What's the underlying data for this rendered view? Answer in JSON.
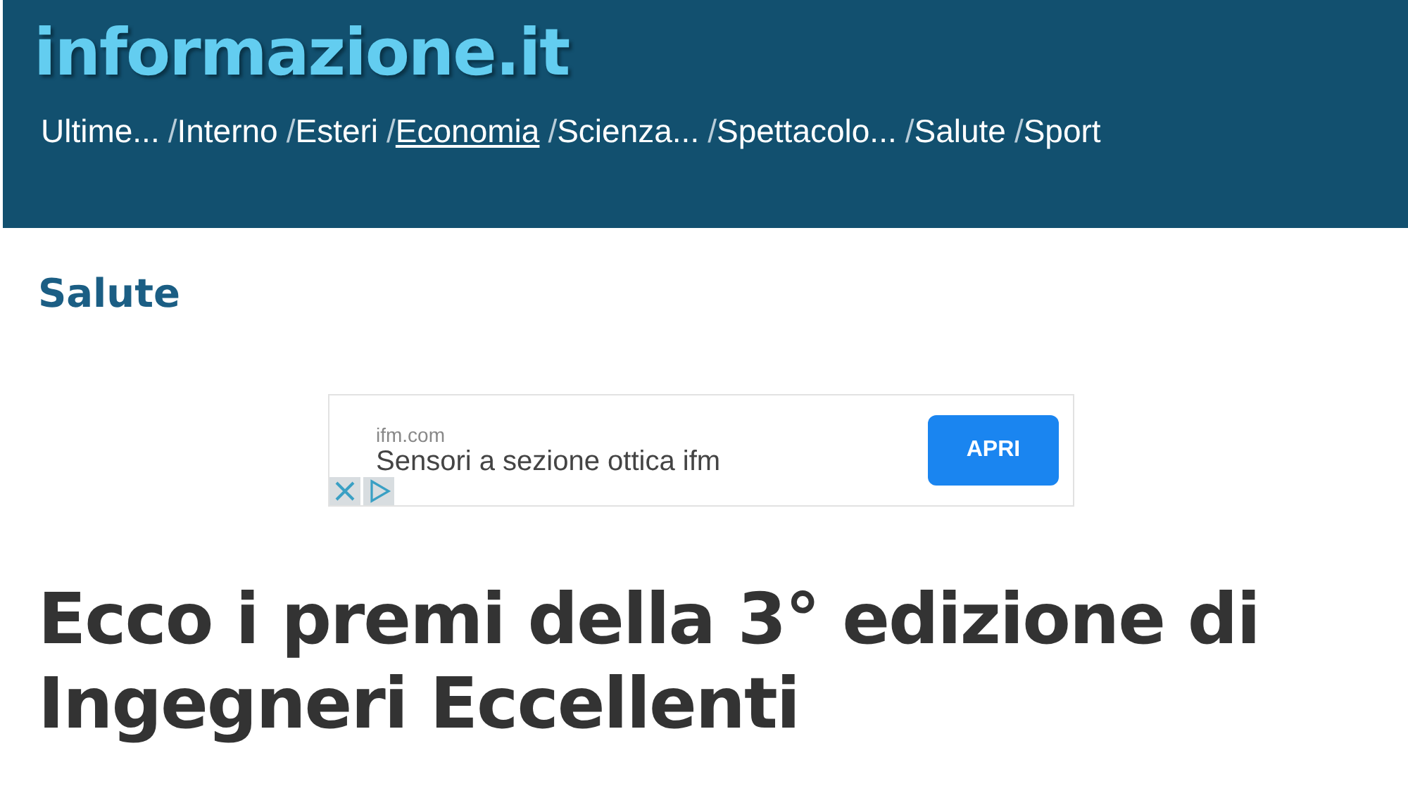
{
  "site": {
    "logo": "informazione.it"
  },
  "nav": [
    {
      "label": "Ultime...",
      "selected": false
    },
    {
      "prefix": "/",
      "label": "Interno",
      "selected": false
    },
    {
      "prefix": "/",
      "label": "Esteri",
      "selected": false
    },
    {
      "prefix": "/",
      "label": "Economia",
      "selected": true
    },
    {
      "prefix": "/",
      "label": "Scienza...",
      "selected": false
    },
    {
      "prefix": "/",
      "label": "Spettacolo...",
      "selected": false
    },
    {
      "prefix": "/",
      "label": "Salute",
      "selected": false
    },
    {
      "prefix": "/",
      "label": "Sport",
      "selected": false
    }
  ],
  "section": "Salute",
  "ad": {
    "domain": "ifm.com",
    "text": "Sensori a sezione ottica ifm",
    "button": "APRI"
  },
  "headline": "Ecco i premi della 3° edizione di Ingegneri Eccellenti"
}
